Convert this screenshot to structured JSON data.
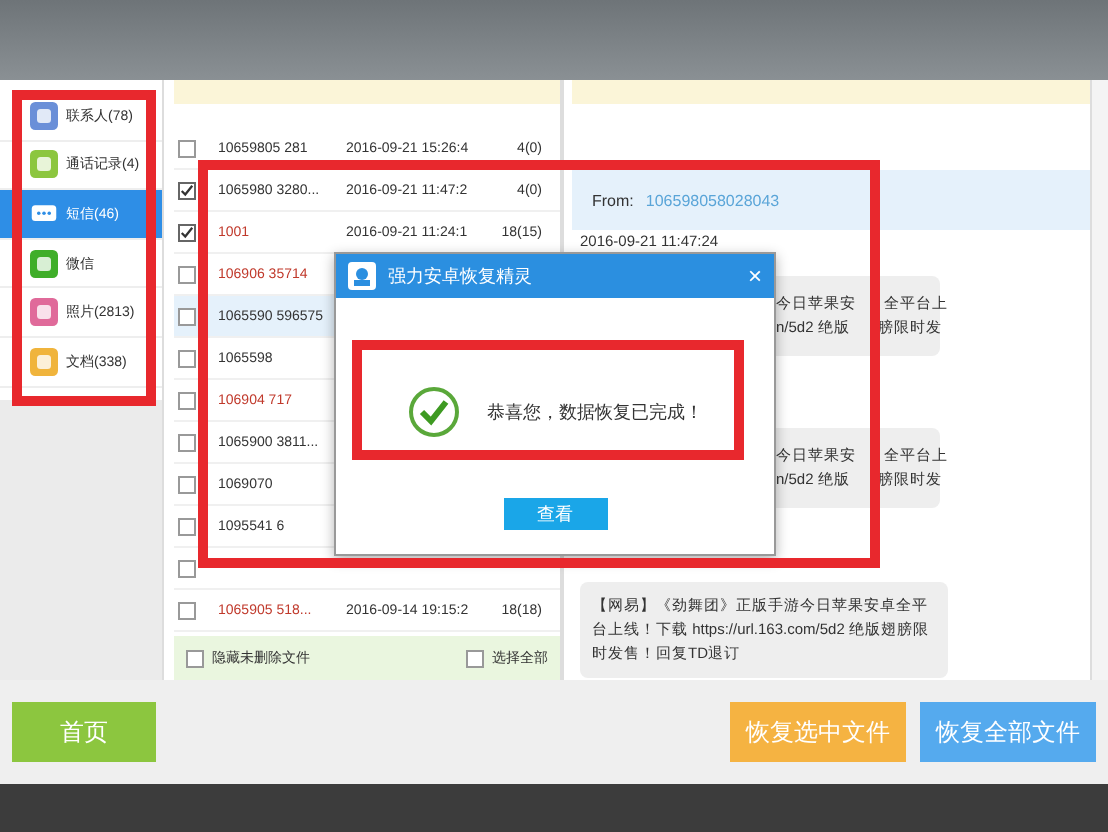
{
  "sidebar": {
    "items": [
      {
        "label": "联系人(78)",
        "kind": "contacts",
        "selected": false
      },
      {
        "label": "通话记录(4)",
        "kind": "calls",
        "selected": false
      },
      {
        "label": "短信(46)",
        "kind": "sms",
        "selected": true
      },
      {
        "label": "微信",
        "kind": "wechat",
        "selected": false
      },
      {
        "label": "照片(2813)",
        "kind": "photos",
        "selected": false
      },
      {
        "label": "文档(338)",
        "kind": "docs",
        "selected": false
      }
    ]
  },
  "message_list": {
    "rows": [
      {
        "sender": "10659805 281",
        "date": "2016-09-21 15:26:4",
        "count": "4(0)",
        "checked": false,
        "deleted": false,
        "selected": false
      },
      {
        "sender": "1065980 3280...",
        "date": "2016-09-21 11:47:2",
        "count": "4(0)",
        "checked": true,
        "deleted": false,
        "selected": false
      },
      {
        "sender": "1001",
        "date": "2016-09-21 11:24:1",
        "count": "18(15)",
        "checked": true,
        "deleted": true,
        "selected": false
      },
      {
        "sender": "106906 35714",
        "checked": false,
        "deleted": true,
        "selected": false
      },
      {
        "sender": "1065590 596575",
        "checked": false,
        "deleted": false,
        "selected": true
      },
      {
        "sender": "1065598",
        "checked": false,
        "deleted": false,
        "selected": false
      },
      {
        "sender": "106904 717",
        "checked": false,
        "deleted": true,
        "selected": false
      },
      {
        "sender": "1065900 3811...",
        "checked": false,
        "deleted": false,
        "selected": false
      },
      {
        "sender": "1069070",
        "checked": false,
        "deleted": false,
        "selected": false
      },
      {
        "sender": "1095541 6",
        "checked": false,
        "deleted": false,
        "selected": false
      },
      {
        "checked": false,
        "selected": false
      },
      {
        "sender": "1065905 518...",
        "date": "2016-09-14 19:15:2",
        "count": "18(18)",
        "checked": false,
        "deleted": true,
        "selected": false
      }
    ],
    "hide_undeleted": {
      "label": "隐藏未删除文件",
      "checked": false
    },
    "select_all": {
      "label": "选择全部",
      "checked": false
    }
  },
  "conversation": {
    "from_label": "From:",
    "from_number": "106598058028043",
    "date": "2016-09-21 11:47:24",
    "messages": [
      {
        "kind": "partial",
        "lines": [
          [
            "今日苹果安",
            "全平台上"
          ],
          [
            "n/5d2 绝版",
            "膀限时发"
          ]
        ]
      },
      {
        "kind": "partial",
        "lines": [
          [
            "今日苹果安",
            "全平台上"
          ],
          [
            "n/5d2 绝版",
            "膀限时发"
          ]
        ]
      },
      {
        "kind": "full",
        "text": "【网易】《劲舞团》正版手游今日苹果安卓全平台上线！下载 https://url.163.com/5d2 绝版翅膀限时发售！回复TD退订"
      }
    ]
  },
  "dialog": {
    "title": "强力安卓恢复精灵",
    "close": "×",
    "message": "恭喜您，数据恢复已完成！",
    "button": "查看"
  },
  "buttons": {
    "home": "首页",
    "recover_selected": "恢复选中文件",
    "recover_all": "恢复全部文件"
  }
}
